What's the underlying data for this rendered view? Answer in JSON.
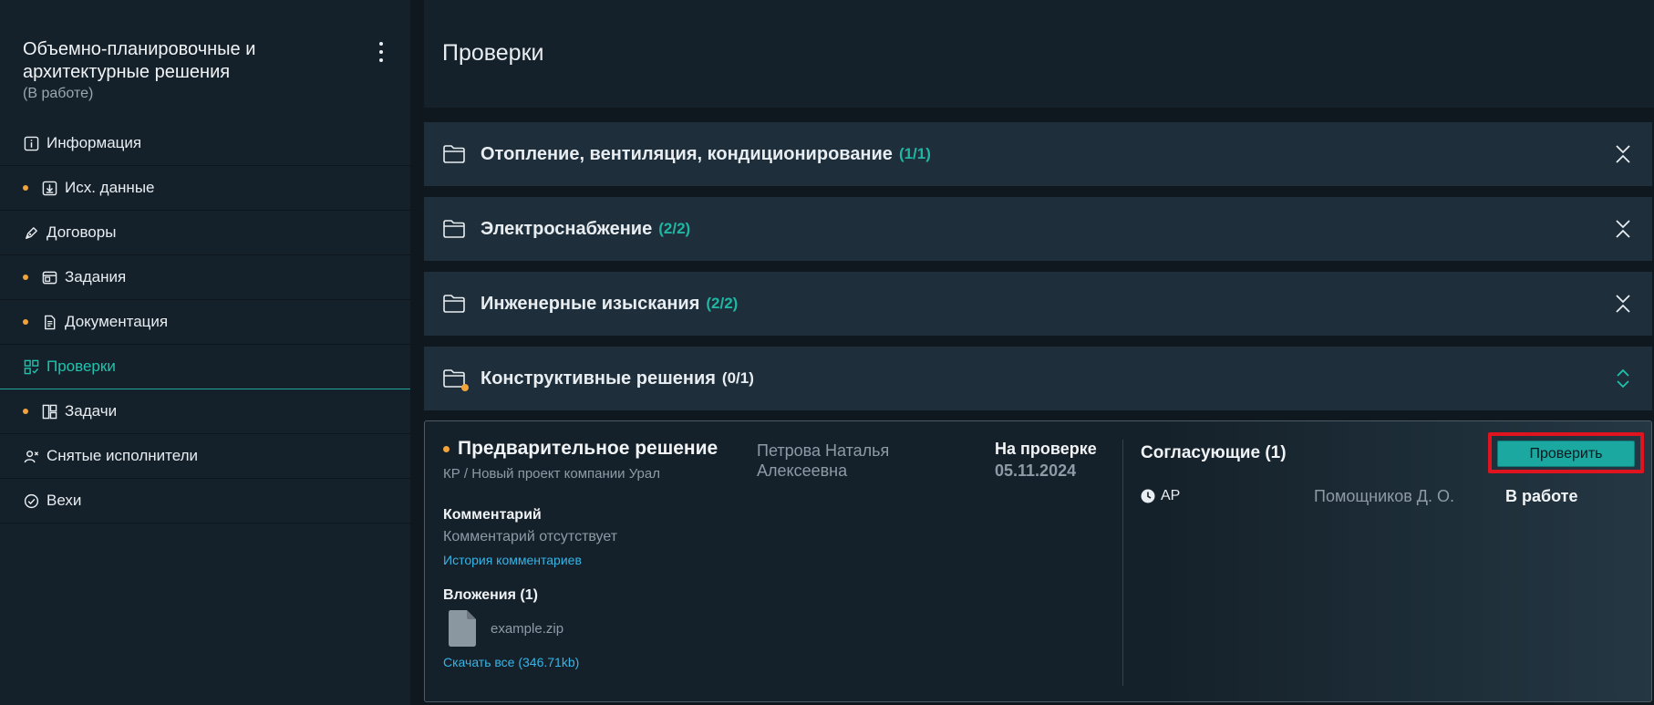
{
  "sidebar": {
    "project_title": "Объемно-планировочные и архитектурные решения",
    "project_status": "(В работе)",
    "items": [
      {
        "label": "Информация",
        "icon": "info-icon",
        "dot": false,
        "active": false
      },
      {
        "label": "Исх. данные",
        "icon": "download-box-icon",
        "dot": true,
        "active": false
      },
      {
        "label": "Договоры",
        "icon": "pen-icon",
        "dot": false,
        "active": false
      },
      {
        "label": "Задания",
        "icon": "window-icon",
        "dot": true,
        "active": false
      },
      {
        "label": "Документация",
        "icon": "document-icon",
        "dot": true,
        "active": false
      },
      {
        "label": "Проверки",
        "icon": "grid-check-icon",
        "dot": false,
        "active": true
      },
      {
        "label": "Задачи",
        "icon": "board-icon",
        "dot": true,
        "active": false
      },
      {
        "label": "Снятые исполнители",
        "icon": "user-remove-icon",
        "dot": false,
        "active": false
      },
      {
        "label": "Вехи",
        "icon": "check-circle-icon",
        "dot": false,
        "active": false
      }
    ]
  },
  "header": {
    "title": "Проверки"
  },
  "sections": [
    {
      "title": "Отопление, вентиляция, кондиционирование",
      "count": "(1/1)",
      "count_color": "#1fb7a3",
      "expanded": false,
      "alert": false
    },
    {
      "title": "Электроснабжение",
      "count": "(2/2)",
      "count_color": "#1fb7a3",
      "expanded": false,
      "alert": false
    },
    {
      "title": "Инженерные изыскания",
      "count": "(2/2)",
      "count_color": "#1fb7a3",
      "expanded": false,
      "alert": false
    },
    {
      "title": "Конструктивные решения",
      "count": "(0/1)",
      "count_color": "#e8edf1",
      "expanded": true,
      "alert": true
    }
  ],
  "card": {
    "title": "Предварительное решение",
    "subtitle": "КР / Новый проект компании Урал",
    "person_line1": "Петрова Наталья",
    "person_line2": "Алексеевна",
    "status": "На проверке",
    "date": "05.11.2024",
    "comment_label": "Комментарий",
    "comment_text": "Комментарий отсутствует",
    "comment_history_link": "История комментариев",
    "attachments_label": "Вложения (1)",
    "file_name": "example.zip",
    "download_all_link": "Скачать все (346.71kb)",
    "approvers_title": "Согласующие (1)",
    "approver_role": "АР",
    "approver_name": "Помощников Д. О.",
    "approver_status": "В работе",
    "check_button": "Проверить"
  },
  "colors": {
    "accent": "#1fc3ad",
    "alert_dot": "#f2a33a",
    "link": "#36b4e6",
    "highlight_frame": "#e0141e"
  }
}
